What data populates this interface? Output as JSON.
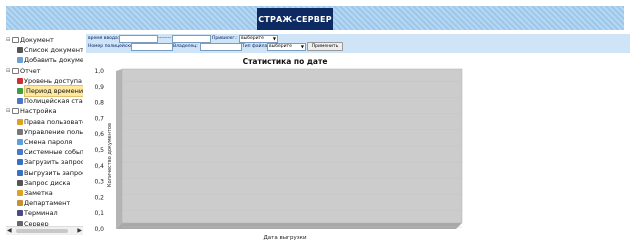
{
  "header": {
    "logo_text": "СТРАЖ-СЕРВЕР"
  },
  "sidebar": {
    "items": [
      {
        "label": "Документ",
        "icon": "document-group-icon",
        "level": 0
      },
      {
        "label": "Список документов",
        "icon": "list-icon",
        "level": 1
      },
      {
        "label": "Добавить документ",
        "icon": "add-document-icon",
        "level": 1
      },
      {
        "label": "Отчет",
        "icon": "report-group-icon",
        "level": 0
      },
      {
        "label": "Уровень доступа",
        "icon": "access-level-icon",
        "level": 1
      },
      {
        "label": "Период времени",
        "icon": "time-period-icon",
        "level": 1,
        "selected": true
      },
      {
        "label": "Полицейская статистика",
        "icon": "police-stats-icon",
        "level": 1
      },
      {
        "label": "Настройка",
        "icon": "settings-group-icon",
        "level": 0
      },
      {
        "label": "Права пользователей",
        "icon": "key-icon",
        "level": 1
      },
      {
        "label": "Управление пользователями",
        "icon": "users-icon",
        "level": 1
      },
      {
        "label": "Смена пароля",
        "icon": "password-icon",
        "level": 1
      },
      {
        "label": "Системные события",
        "icon": "events-icon",
        "level": 1
      },
      {
        "label": "Загрузить запрос",
        "icon": "upload-icon",
        "level": 1
      },
      {
        "label": "Выгрузить запрос",
        "icon": "download-icon",
        "level": 1
      },
      {
        "label": "Запрос диска",
        "icon": "disk-icon",
        "level": 1
      },
      {
        "label": "Заметка",
        "icon": "note-icon",
        "level": 1
      },
      {
        "label": "Департамент",
        "icon": "department-icon",
        "level": 1
      },
      {
        "label": "Терминал",
        "icon": "terminal-icon",
        "level": 1
      },
      {
        "label": "Сервер",
        "icon": "server-icon",
        "level": 1
      }
    ]
  },
  "filters": {
    "time_label": "время ввода:",
    "separator": "--------",
    "privilege_label": "Привилег.:",
    "privilege_value": "выберите",
    "police_num_label": "Номер полицейского:",
    "ownership_label": "Владелец:",
    "file_type_label": "Тип файла:",
    "file_type_value": "выберите",
    "apply_button": "Применить"
  },
  "colors": {
    "header_stripe_a": "#9cc7ea",
    "header_stripe_b": "#b6d7f1",
    "logo_bg": "#0d2a63",
    "filter_bg": "#cfe4f6",
    "plot_bg": "#cccccc",
    "selected_bg": "#ffe8a0"
  },
  "chart_data": {
    "type": "bar",
    "title": "Статистика по дате",
    "xlabel": "Дата выгрузки",
    "ylabel": "Количество документов",
    "categories": [],
    "values": [],
    "ylim": [
      0,
      1.0
    ],
    "yticks": [
      "0,0",
      "0,1",
      "0,2",
      "0,3",
      "0,4",
      "0,5",
      "0,6",
      "0,7",
      "0,8",
      "0,9",
      "1,0"
    ],
    "grid": true
  }
}
